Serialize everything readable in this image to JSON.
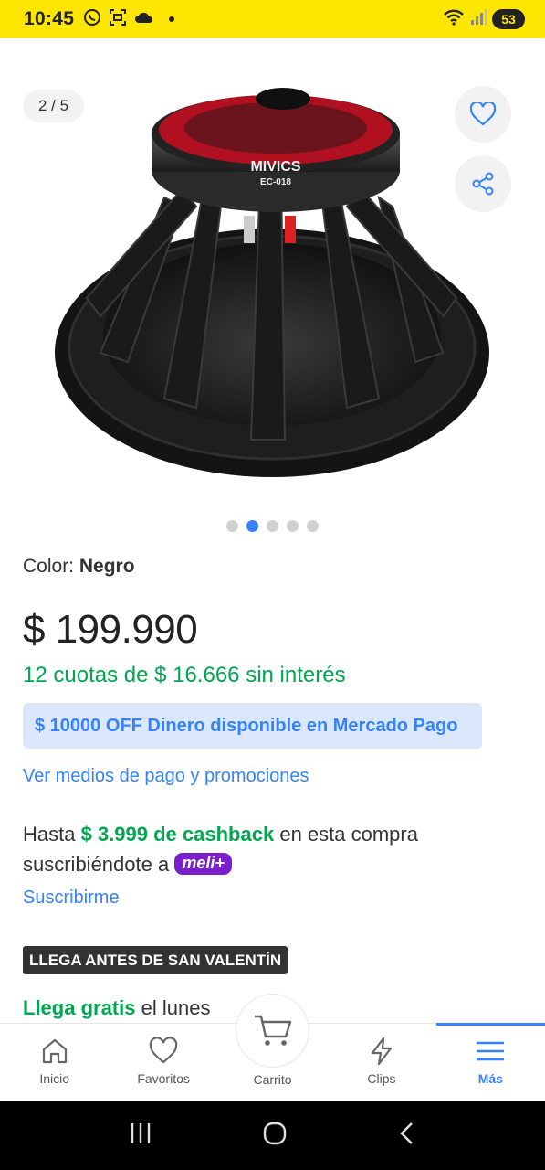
{
  "status_bar": {
    "time": "10:45",
    "battery": "53",
    "icons": [
      "whatsapp-icon",
      "screenshot-icon",
      "cloud-icon",
      "dot-icon",
      "wifi-icon",
      "signal-icon",
      "battery-icon"
    ]
  },
  "gallery": {
    "counter": "2 / 5",
    "image_brand_text": "MIVICS",
    "image_model_text": "EC-018",
    "dots_total": 5,
    "dots_active_index": 1
  },
  "product": {
    "color_label": "Color:",
    "color_value": "Negro",
    "price": "$ 199.990",
    "installments": "12 cuotas de $ 16.666 sin interés",
    "promo_banner": "$ 10000 OFF Dinero disponible en Mercado Pago",
    "payment_link": "Ver medios de pago y promociones",
    "cashback_prefix": "Hasta",
    "cashback_amount": "$ 3.999 de cashback",
    "cashback_suffix": "en esta compra",
    "cashback_line2": "suscribiéndote a",
    "meli_badge": "meli+",
    "subscribe_link": "Suscribirme",
    "tag": "LLEGA ANTES DE SAN VALENTÍN",
    "delivery_green": "Llega gratis",
    "delivery_rest": "el lunes"
  },
  "bottom_nav": {
    "items": [
      {
        "label": "Inicio",
        "icon": "home-icon"
      },
      {
        "label": "Favoritos",
        "icon": "heart-icon"
      },
      {
        "label": "Carrito",
        "icon": "cart-icon"
      },
      {
        "label": "Clips",
        "icon": "lightning-icon"
      },
      {
        "label": "Más",
        "icon": "menu-icon"
      }
    ],
    "active_index": 4
  },
  "colors": {
    "status_bar": "#ffe600",
    "accent_blue": "#3483fa",
    "green": "#00a650",
    "promo_bg": "#dbe7fb",
    "meli_purple": "#7a1fc9"
  }
}
